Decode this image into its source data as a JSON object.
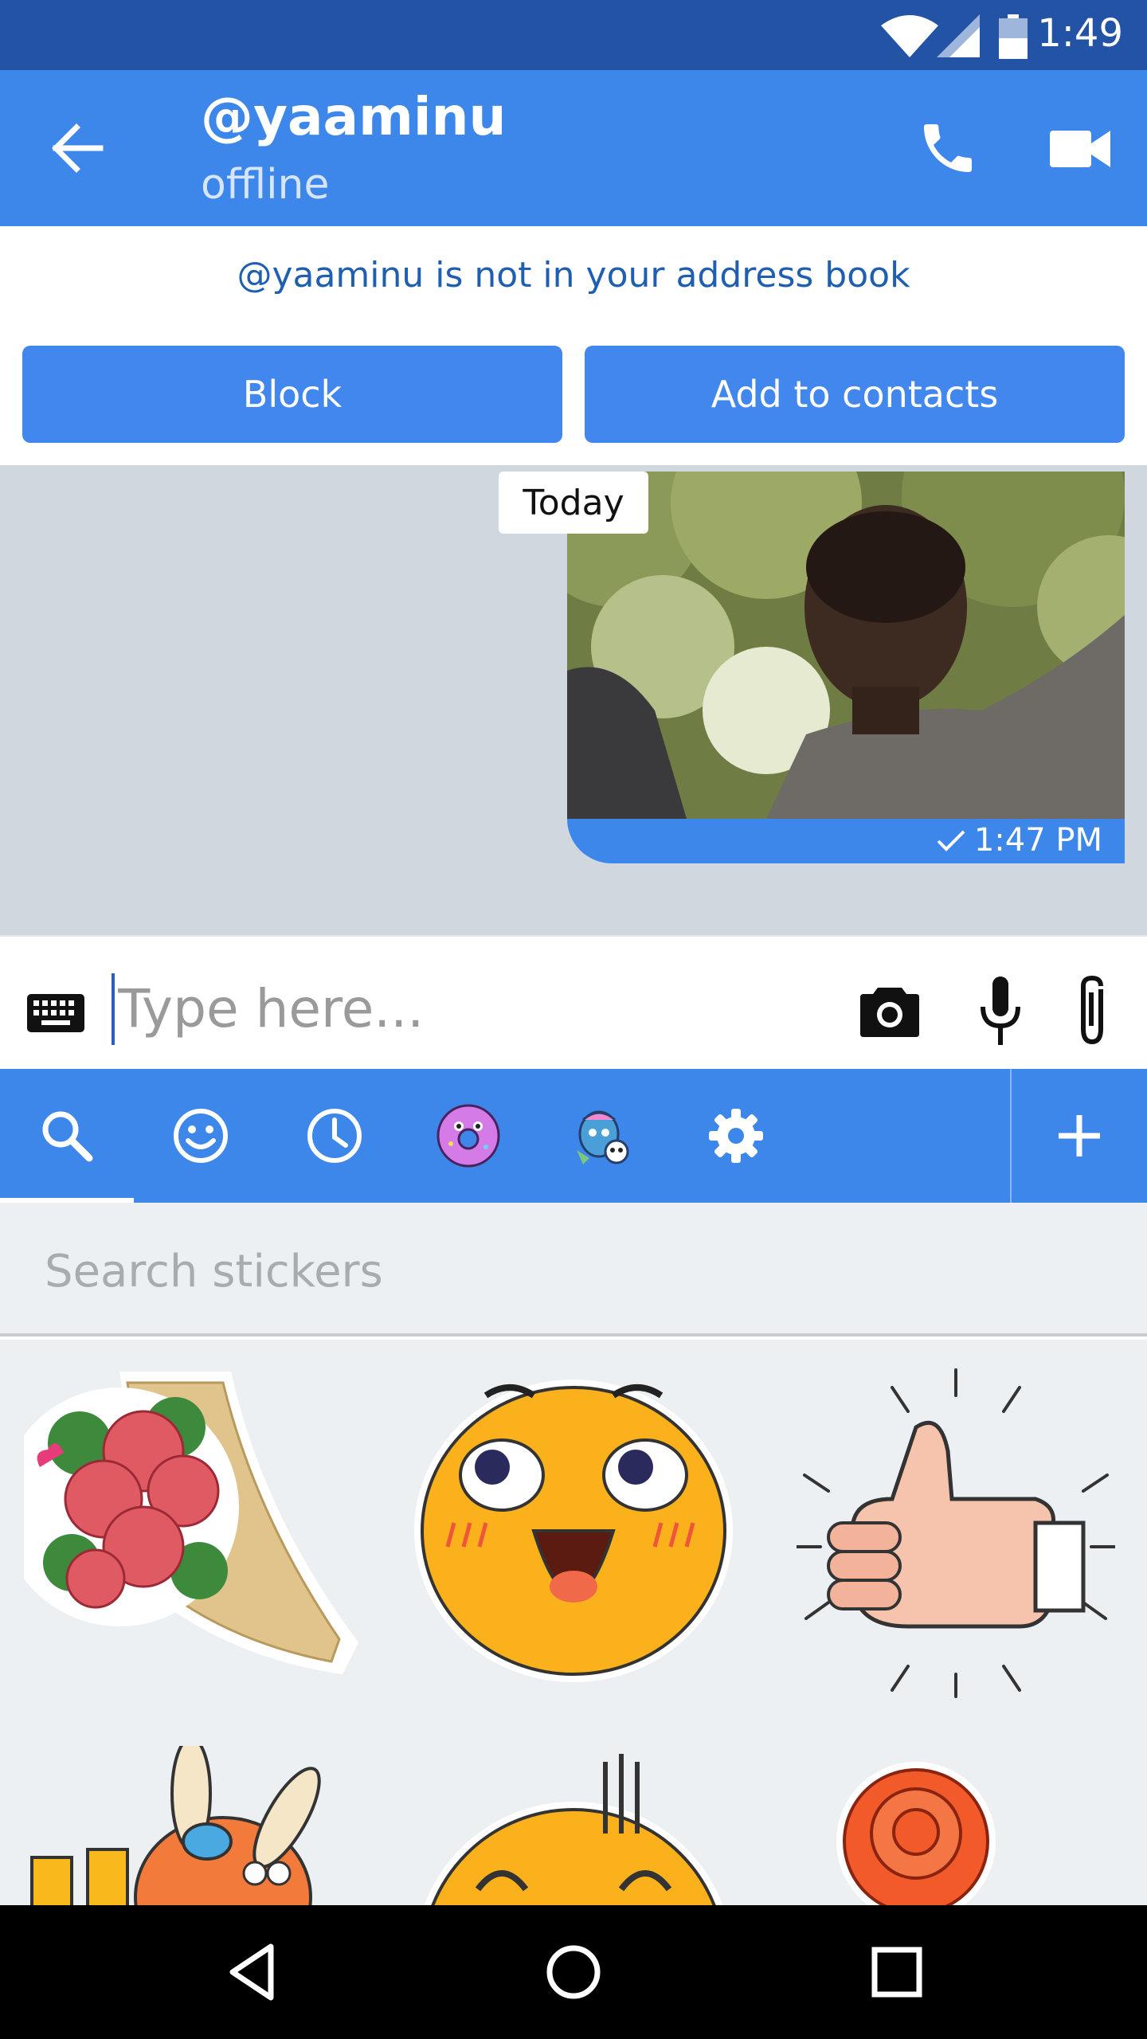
{
  "status_bar": {
    "time": "1:49",
    "icons": [
      "wifi-icon",
      "signal-icon",
      "battery-icon"
    ]
  },
  "header": {
    "title": "@yaaminu",
    "subtitle": "offline",
    "icons": [
      "back-arrow-icon",
      "phone-icon",
      "video-camera-icon"
    ]
  },
  "notice": {
    "message": "@yaaminu is not in your address book",
    "block_label": "Block",
    "add_label": "Add to contacts"
  },
  "chat": {
    "date_chip": "Today",
    "messages": [
      {
        "type": "photo",
        "time": "1:47 PM",
        "status": "sent"
      }
    ]
  },
  "composer": {
    "placeholder": "Type here...",
    "icons": [
      "keyboard-icon",
      "camera-icon",
      "microphone-icon",
      "paperclip-icon"
    ]
  },
  "sticker_tabs": {
    "icons": [
      "search-icon",
      "smiley-icon",
      "clock-icon",
      "donut-sticker-icon",
      "monster-sticker-icon",
      "gear-icon",
      "plus-icon"
    ],
    "active": 0
  },
  "sticker_search": {
    "placeholder": "Search stickers"
  },
  "stickers": [
    "rose-bouquet-sticker",
    "excited-face-sticker",
    "thumbs-up-sticker",
    "bunny-sticker",
    "sweating-face-sticker",
    "red-rose-sticker"
  ],
  "nav": {
    "icons": [
      "back-triangle-icon",
      "home-circle-icon",
      "recents-square-icon"
    ]
  },
  "colors": {
    "primary": "#3d86ea",
    "status_bar": "#2353a5",
    "chat_bg": "#d0d7de",
    "link": "#1f5fb1"
  }
}
